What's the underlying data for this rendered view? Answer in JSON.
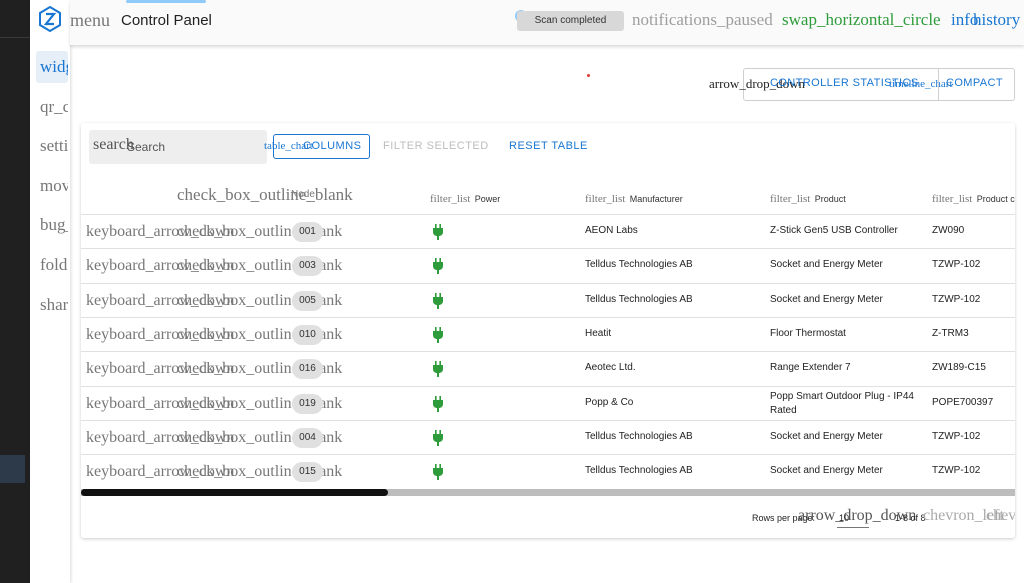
{
  "app": {
    "title": "Control Panel",
    "menu_icon": "menu",
    "scan_status": "Scan completed",
    "notifications_icon": "notifications_paused",
    "swap_icon": "swap_horizontal_circle",
    "info_icon": "info",
    "history_icon": "history",
    "accent_color": "#1976d2",
    "success_color": "#2e9c3a"
  },
  "nav": {
    "items": [
      {
        "label": "widgets",
        "active": true
      },
      {
        "label": "qr_code"
      },
      {
        "label": "settings"
      },
      {
        "label": "move"
      },
      {
        "label": "bug_report"
      },
      {
        "label": "folder"
      },
      {
        "label": "share"
      }
    ]
  },
  "actions": {
    "dropdown_icon": "arrow_drop_down",
    "controller_statistics": "CONTROLLER STATISTICS",
    "timeline_icon": "timeline_chart",
    "compact": "COMPACT"
  },
  "toolbar": {
    "search_icon": "search",
    "search_placeholder": "Search",
    "table_chart_icon": "table_chart",
    "columns": "COLUMNS",
    "filter_selected": "FILTER SELECTED",
    "reset_table": "RESET TABLE"
  },
  "table": {
    "header_checkbox": "check_box_outline_blank",
    "header_node": "Node",
    "filter_icon": "filter_list",
    "columns": [
      "Power",
      "Manufacturer",
      "Product",
      "Product c"
    ],
    "expand_icon": "keyboard_arrow_down",
    "row_checkbox": "check_box_outline_blank",
    "rows": [
      {
        "id": "001",
        "manufacturer": "AEON Labs",
        "product": "Z-Stick Gen5 USB Controller",
        "code": "ZW090"
      },
      {
        "id": "003",
        "manufacturer": "Telldus Technologies AB",
        "product": "Socket and Energy Meter",
        "code": "TZWP-102"
      },
      {
        "id": "005",
        "manufacturer": "Telldus Technologies AB",
        "product": "Socket and Energy Meter",
        "code": "TZWP-102"
      },
      {
        "id": "010",
        "manufacturer": "Heatit",
        "product": "Floor Thermostat",
        "code": "Z-TRM3"
      },
      {
        "id": "016",
        "manufacturer": "Aeotec Ltd.",
        "product": "Range Extender 7",
        "code": "ZW189-C15"
      },
      {
        "id": "019",
        "manufacturer": "Popp & Co",
        "product": "Popp Smart Outdoor Plug - IP44 Rated",
        "code": "POPE700397"
      },
      {
        "id": "004",
        "manufacturer": "Telldus Technologies AB",
        "product": "Socket and Energy Meter",
        "code": "TZWP-102"
      },
      {
        "id": "015",
        "manufacturer": "Telldus Technologies AB",
        "product": "Socket and Energy Meter",
        "code": "TZWP-102"
      }
    ]
  },
  "footer": {
    "rows_per_page_label": "Rows per page:",
    "rows_per_page_value": "10",
    "dropdown_icon": "arrow_drop_down",
    "range": "1-8 of 8",
    "prev_icon": "chevron_left",
    "next_icon": "chevron_right"
  }
}
